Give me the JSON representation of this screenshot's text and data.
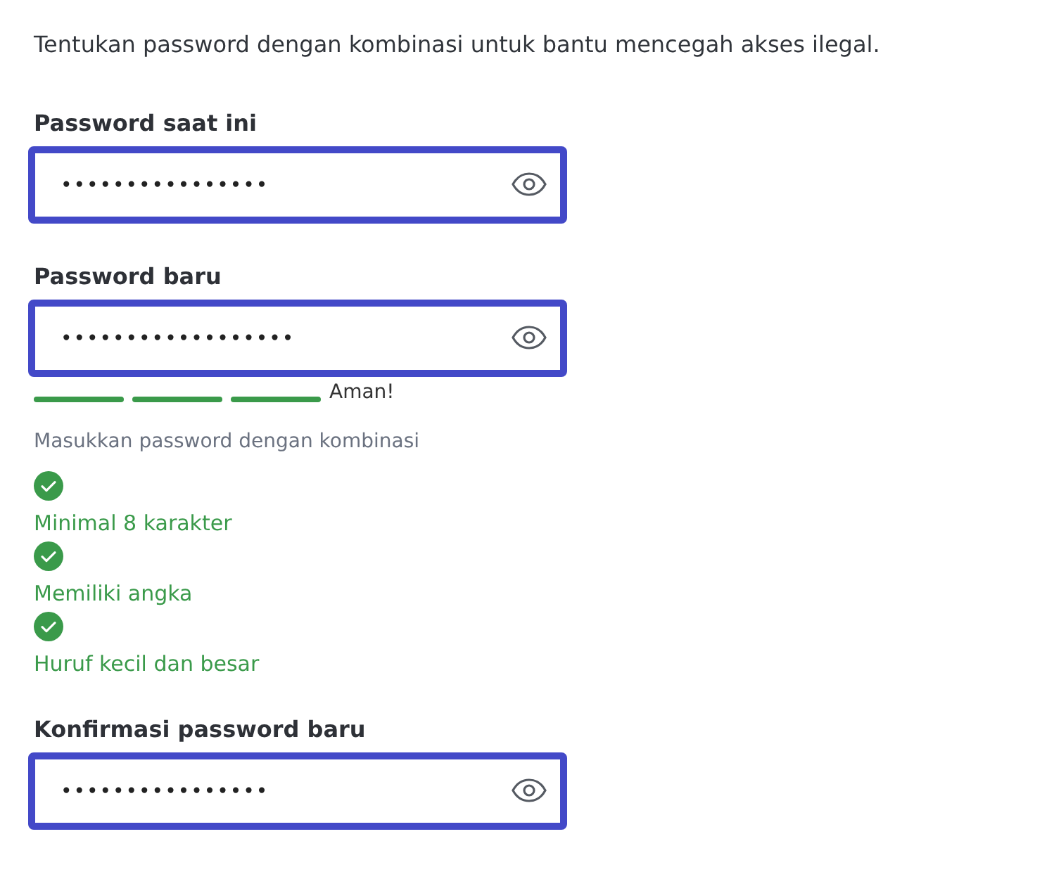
{
  "intro": "Tentukan password dengan kombinasi untuk bantu mencegah akses ilegal.",
  "fields": [
    {
      "label": "Password saat ini",
      "value": "••••••••••••••••",
      "highlighted": true
    },
    {
      "label": "Password baru",
      "value": "••••••••••••••••••",
      "highlighted": true,
      "strength": {
        "segments": [
          {
            "filled": true
          },
          {
            "filled": true
          },
          {
            "filled": true
          }
        ],
        "label": "Aman!"
      },
      "hint": "Masukkan password dengan kombinasi",
      "rules": [
        {
          "text": "Minimal 8 karakter",
          "met": true
        },
        {
          "text": "Memiliki angka",
          "met": true
        },
        {
          "text": "Huruf kecil dan besar",
          "met": true
        }
      ]
    },
    {
      "label": "Konfirmasi password baru",
      "value": "••••••••••••••••",
      "highlighted": true
    }
  ]
}
